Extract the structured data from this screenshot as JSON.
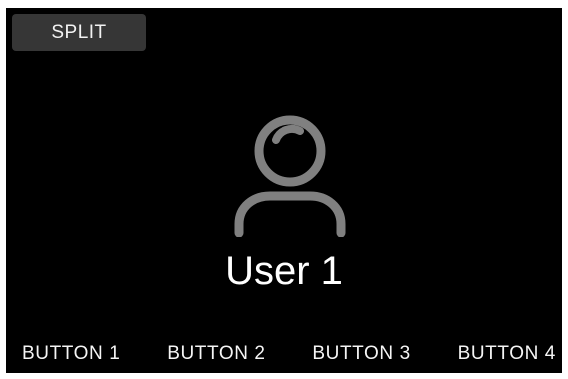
{
  "header": {
    "split_label": "SPLIT"
  },
  "profile": {
    "icon": "user-icon",
    "name": "User 1"
  },
  "bottom_bar": {
    "buttons": [
      {
        "label": "BUTTON 1"
      },
      {
        "label": "BUTTON 2"
      },
      {
        "label": "BUTTON 3"
      },
      {
        "label": "BUTTON 4"
      }
    ]
  },
  "colors": {
    "screen_background": "#000000",
    "icon_gray": "#808080",
    "button_background": "#363636",
    "text": "#ffffff"
  }
}
